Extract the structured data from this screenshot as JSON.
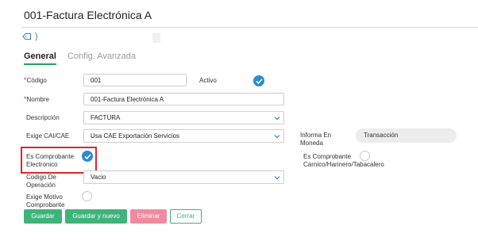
{
  "header": {
    "title": "001-Factura Electrónica A"
  },
  "tags": {
    "icon": "tag-icon",
    "chevron": ")"
  },
  "tabs": [
    {
      "label": "General",
      "active": true
    },
    {
      "label": "Config. Avanzada",
      "active": false
    }
  ],
  "form": {
    "codigo": {
      "label": "Código",
      "value": "001",
      "required": true
    },
    "activo": {
      "label": "Activo",
      "checked": true
    },
    "nombre": {
      "label": "Nombre",
      "value": "001-Factura Electrónica A",
      "required": true
    },
    "descripcion": {
      "label": "Descripción",
      "value": "FACTURA"
    },
    "exige_cai": {
      "label": "Exige CAI/CAE",
      "value": "Usa CAE Exportación Servicios"
    },
    "informa_moneda": {
      "label_line1": "Informa En",
      "label_line2": "Moneda",
      "value": "Transacción"
    },
    "es_comprobante_electronico": {
      "label_line1": "Es Comprobante",
      "label_line2": "Electronico",
      "checked": true
    },
    "es_comprobante_carnico": {
      "label_line1": "Es Comprobante",
      "label_line2": "Carnico/Harinero/Tabacalero",
      "checked": false
    },
    "codigo_operacion": {
      "label_line1": "Codigo De",
      "label_line2": "Operación",
      "value": "Vacio"
    },
    "exige_motivo": {
      "label_line1": "Exige Motivo",
      "label_line2": "Comprobante",
      "checked": false
    }
  },
  "buttons": {
    "guardar": "Guardar",
    "guardar_nuevo": "Guardar y nuevo",
    "eliminar": "Eliminar",
    "cerrar": "Cerrar"
  },
  "colors": {
    "accent_green": "#3fb47a",
    "check_blue": "#2b8ad1",
    "danger_pink": "#f08aa0",
    "highlight_red": "#e0232d"
  }
}
